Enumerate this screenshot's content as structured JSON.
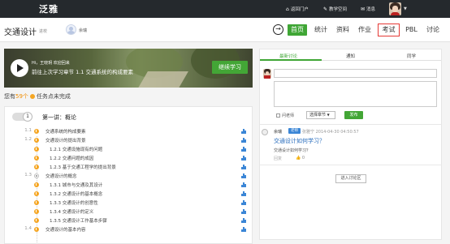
{
  "topbar": {
    "logo": "泛雅",
    "nav": [
      {
        "icon": "home-icon",
        "glyph": "⌂",
        "label": "返回门户"
      },
      {
        "icon": "edit-icon",
        "glyph": "✎",
        "label": "教学空间"
      },
      {
        "icon": "mail-icon",
        "glyph": "✉",
        "label": "消息"
      }
    ]
  },
  "header": {
    "course_title": "交通设计",
    "course_sub": "进校",
    "teacher": "余瑞",
    "tabs": [
      "首页",
      "统计",
      "资料",
      "作业",
      "考试",
      "PBL",
      "讨论"
    ],
    "active_tab": "首页",
    "highlighted_tab": "考试"
  },
  "banner": {
    "greeting": "Hi，王晓玥 欢迎回来",
    "goto": "前往上次学习章节 1.1 交通系统的构成要素",
    "continue_label": "继续学习"
  },
  "progress": {
    "prefix": "您有",
    "count": "59个",
    "suffix": "任务点未完成"
  },
  "chapter": {
    "number": "1",
    "title": "第一讲：概论",
    "items": [
      {
        "num": "1.1",
        "label": "交通系统的构成要素",
        "status": "orange",
        "level": 1
      },
      {
        "num": "1.2",
        "label": "交通设计的提出背景",
        "status": "orange",
        "level": 1
      },
      {
        "num": "",
        "label": "1.2.1 交通设施现有的问题",
        "status": "orange",
        "level": 2
      },
      {
        "num": "",
        "label": "1.2.2 交通问题的成因",
        "status": "orange",
        "level": 2
      },
      {
        "num": "",
        "label": "1.2.3 基于交通工程学的提出背景",
        "status": "orange",
        "level": 2
      },
      {
        "num": "1.3",
        "label": "交通设计的概念",
        "status": "gray",
        "level": 1
      },
      {
        "num": "",
        "label": "1.3.1 城市与交通及其设计",
        "status": "orange",
        "level": 2
      },
      {
        "num": "",
        "label": "1.3.2 交通设计的基本概念",
        "status": "orange",
        "level": 2
      },
      {
        "num": "",
        "label": "1.3.3 交通设计的创意性",
        "status": "orange",
        "level": 2
      },
      {
        "num": "",
        "label": "1.3.4 交通设计的定义",
        "status": "orange",
        "level": 2
      },
      {
        "num": "",
        "label": "1.3.5 交通设计工作基本步骤",
        "status": "orange",
        "level": 2
      },
      {
        "num": "1.4",
        "label": "交通设计的基本内容",
        "status": "orange",
        "level": 1
      }
    ]
  },
  "discussion": {
    "tabs": [
      "最新讨论",
      "通知",
      "同学"
    ],
    "ask_teacher": "问老师",
    "select_chapter": "选择章节",
    "publish": "发布",
    "comment": {
      "author": "余瑞",
      "badge": "老师",
      "meta": "张雅宁 2014-04-30 04:50:57",
      "title": "交通设计如何学习？",
      "body": "交通设计如何学习？",
      "reply": "回复",
      "like": "0"
    },
    "enter_label": "进入讨论区"
  }
}
